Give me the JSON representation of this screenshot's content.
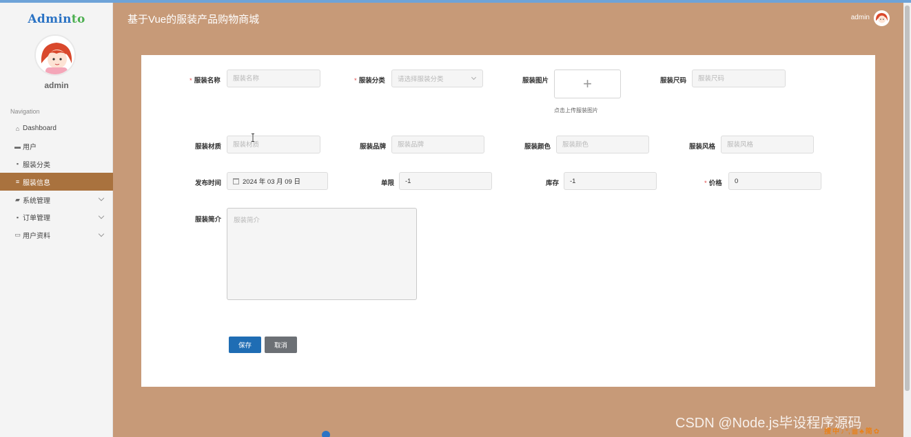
{
  "sidebar": {
    "logo_main": "Admin",
    "logo_tail": "to",
    "username": "admin",
    "nav_title": "Navigation",
    "items": [
      {
        "label": "Dashboard",
        "icon": "home-icon",
        "glyph": "⌂",
        "active": false,
        "expandable": false
      },
      {
        "label": "用户",
        "icon": "user-icon",
        "glyph": "▬",
        "active": false,
        "expandable": false
      },
      {
        "label": "服装分类",
        "icon": "grid-icon",
        "glyph": "▪",
        "active": false,
        "expandable": false
      },
      {
        "label": "服装信息",
        "icon": "list-icon",
        "glyph": "≡",
        "active": true,
        "expandable": false
      },
      {
        "label": "系统管理",
        "icon": "video-icon",
        "glyph": "▰",
        "active": false,
        "expandable": true
      },
      {
        "label": "订单管理",
        "icon": "grid-icon",
        "glyph": "▪",
        "active": false,
        "expandable": true
      },
      {
        "label": "用户资料",
        "icon": "card-icon",
        "glyph": "▭",
        "active": false,
        "expandable": true
      }
    ]
  },
  "header": {
    "title": "基于Vue的服装产品购物商城",
    "username": "admin"
  },
  "form": {
    "name": {
      "label": "服装名称",
      "required": true,
      "placeholder": "服装名称",
      "value": ""
    },
    "category": {
      "label": "服装分类",
      "required": true,
      "placeholder": "请选择服装分类"
    },
    "image": {
      "label": "服装图片",
      "plus": "+",
      "hint": "点击上传服装图片"
    },
    "size": {
      "label": "服装尺码",
      "placeholder": "服装尺码",
      "value": ""
    },
    "material": {
      "label": "服装材质",
      "placeholder": "服装材质",
      "value": ""
    },
    "brand": {
      "label": "服装品牌",
      "placeholder": "服装品牌",
      "value": ""
    },
    "color": {
      "label": "服装颜色",
      "placeholder": "服装颜色",
      "value": ""
    },
    "style": {
      "label": "服装风格",
      "placeholder": "服装风格",
      "value": ""
    },
    "publish_time": {
      "label": "发布时间",
      "value": "2024 年 03 月 09 日"
    },
    "limit": {
      "label": "单限",
      "value": "-1"
    },
    "stock": {
      "label": "库存",
      "value": "-1"
    },
    "price": {
      "label": "价格",
      "required": true,
      "value": "0"
    },
    "intro": {
      "label": "服装简介",
      "placeholder": "服装简介",
      "value": ""
    },
    "save_label": "保存",
    "cancel_label": "取消"
  },
  "watermark": "CSDN @Node.js毕设程序源码",
  "ime": [
    "搜",
    "中",
    "♪",
    "°,",
    "▦",
    "♣",
    "简",
    "✿"
  ],
  "colors": {
    "background": "#c79a78",
    "sidebar_active": "#a9723e",
    "save_button": "#1f6db4",
    "cancel_button": "#6c7075",
    "required_star": "#e04b4b"
  }
}
